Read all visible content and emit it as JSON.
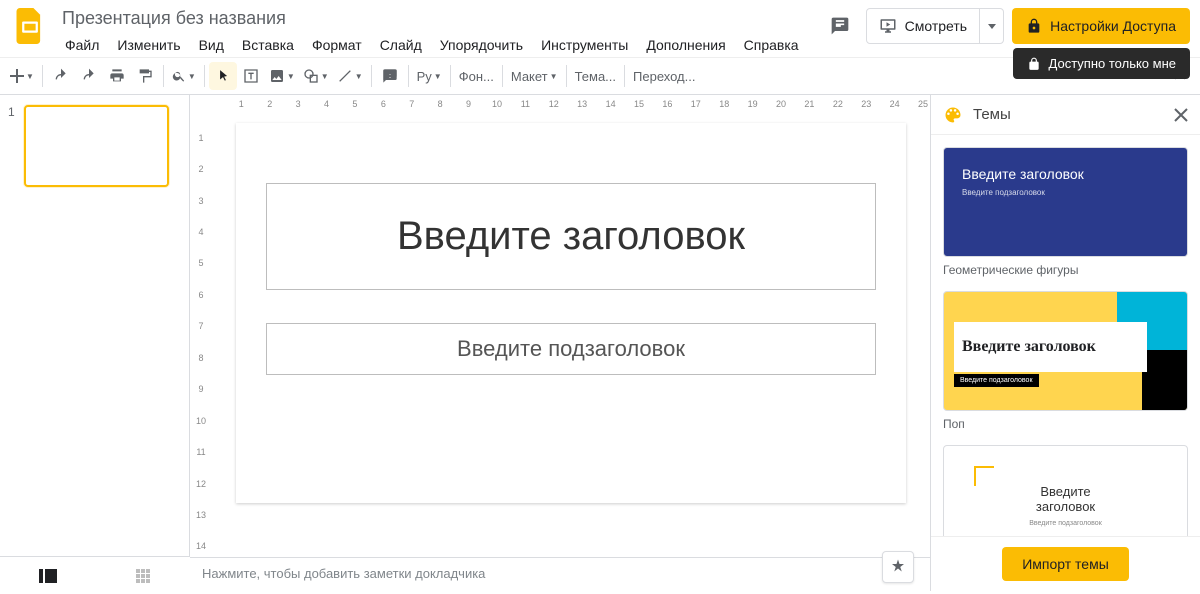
{
  "header": {
    "doc_title": "Презентация без названия",
    "menus": [
      "Файл",
      "Изменить",
      "Вид",
      "Вставка",
      "Формат",
      "Слайд",
      "Упорядочить",
      "Инструменты",
      "Дополнения",
      "Справка"
    ],
    "present_label": "Смотреть",
    "share_label": "Настройки Доступа",
    "tooltip": "Доступно только мне"
  },
  "toolbar": {
    "spellcheck": "Ру",
    "font": "Фон...",
    "layout": "Макет",
    "theme": "Тема...",
    "transition": "Переход..."
  },
  "filmstrip": {
    "slide1_num": "1"
  },
  "ruler_h": [
    "",
    "1",
    "",
    "2",
    "",
    "3",
    "",
    "4",
    "",
    "5",
    "",
    "6",
    "",
    "7",
    "",
    "8",
    "",
    "9",
    "",
    "10",
    "",
    "11",
    "",
    "12",
    "",
    "13",
    "",
    "14",
    "",
    "15",
    "",
    "16",
    "",
    "17",
    "",
    "18",
    "",
    "19",
    "",
    "20",
    "",
    "21",
    "",
    "22",
    "",
    "23",
    "",
    "24",
    "",
    "25"
  ],
  "ruler_v": [
    "",
    "1",
    "",
    "2",
    "",
    "3",
    "",
    "4",
    "",
    "5",
    "",
    "6",
    "",
    "7",
    "",
    "8",
    "",
    "9",
    "",
    "10",
    "",
    "11",
    "",
    "12",
    "",
    "13",
    "",
    "14"
  ],
  "slide": {
    "title_placeholder": "Введите заголовок",
    "subtitle_placeholder": "Введите подзаголовок"
  },
  "notes": {
    "placeholder": "Нажмите, чтобы добавить заметки докладчика"
  },
  "themes_panel": {
    "title": "Темы",
    "t1": {
      "title": "Введите заголовок",
      "sub": "Введите подзаголовок",
      "name": "Геометрические фигуры"
    },
    "t2": {
      "title": "Введите заголовок",
      "sub": "Введите подзаголовок",
      "name": "Поп"
    },
    "t3": {
      "title": "Введите\nзаголовок",
      "sub": "Введите подзаголовок"
    },
    "import_label": "Импорт темы"
  }
}
